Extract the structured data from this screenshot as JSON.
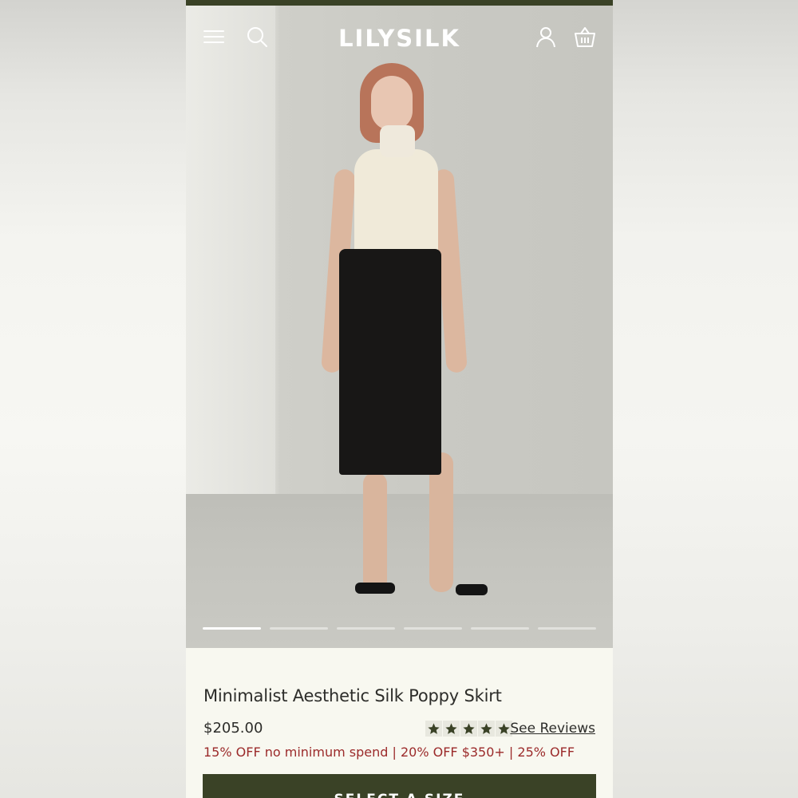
{
  "header": {
    "logo": "LILYSILK",
    "icons": [
      "menu-icon",
      "search-icon",
      "account-icon",
      "cart-icon"
    ]
  },
  "gallery": {
    "slide_count": 6,
    "active_index": 0
  },
  "product": {
    "title": "Minimalist Aesthetic Silk Poppy Skirt",
    "price": "$205.00",
    "rating": 5,
    "reviews_link": "See Reviews",
    "promo": "15% OFF no minimum spend | 20% OFF $350+ | 25% OFF",
    "cta_label": "SELECT A SIZE"
  },
  "colors": {
    "brand_green": "#3a4226",
    "promo_red": "#9b2a2a",
    "background": "#f8f8f0"
  }
}
